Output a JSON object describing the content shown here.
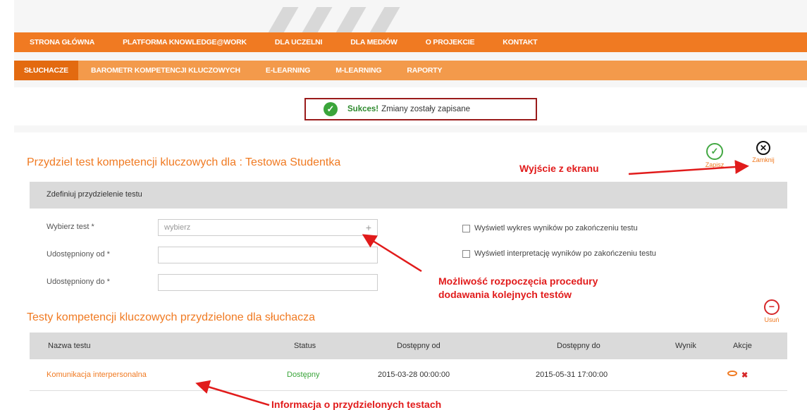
{
  "nav_main": [
    "STRONA GŁÓWNA",
    "PLATFORMA KNOWLEDGE@WORK",
    "DLA UCZELNI",
    "DLA MEDIÓW",
    "O PROJEKCIE",
    "KONTAKT"
  ],
  "nav_sub": [
    "SŁUCHACZE",
    "BAROMETR KOMPETENCJI KLUCZOWYCH",
    "E-LEARNING",
    "M-LEARNING",
    "RAPORTY"
  ],
  "success": {
    "bold": "Sukces!",
    "message": "Zmiany zostały zapisane"
  },
  "assign_title": "Przydziel test kompetencji kluczowych dla : Testowa Studentka",
  "actions": {
    "save": "Zapisz",
    "close": "Zamknij",
    "remove": "Usuń"
  },
  "section_title": "Zdefiniuj przydzielenie testu",
  "form": {
    "test_label": "Wybierz test *",
    "test_placeholder": "wybierz",
    "from_label": "Udostępniony od *",
    "to_label": "Udostępniony do *"
  },
  "checkboxes": [
    "Wyświetl wykres wyników po zakończeniu testu",
    "Wyświetl interpretację wyników po zakończeniu testu"
  ],
  "annotations": {
    "exit": "Wyjście z ekranu",
    "add_line1": "Możliwość rozpoczęcia procedury",
    "add_line2": "dodawania kolejnych testów",
    "info": "Informacja o przydzielonych testach"
  },
  "assigned_title": "Testy kompetencji kluczowych przydzielone dla słuchacza",
  "table": {
    "headers": [
      "Nazwa testu",
      "Status",
      "Dostępny od",
      "Dostępny do",
      "Wynik",
      "Akcje"
    ],
    "rows": [
      {
        "name": "Komunikacja interpersonalna",
        "status": "Dostępny",
        "from": "2015-03-28 00:00:00",
        "to": "2015-05-31 17:00:00",
        "result": ""
      }
    ]
  },
  "colors": {
    "accent": "#f07a22",
    "success": "#3aa53a",
    "annotation": "#e11b1b"
  }
}
